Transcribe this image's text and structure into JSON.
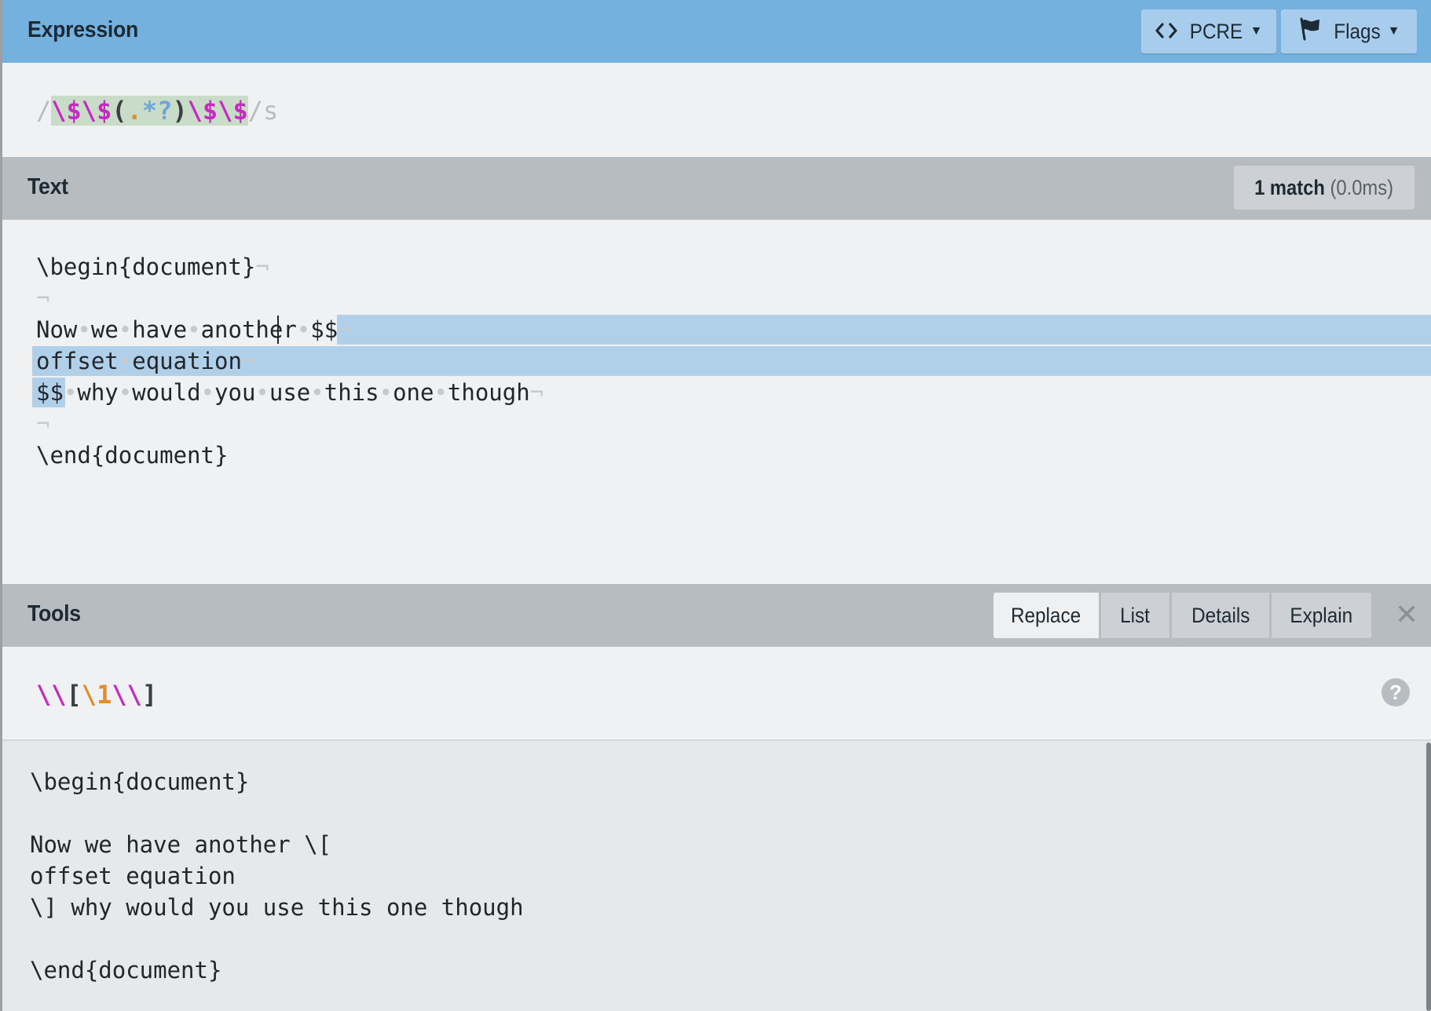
{
  "expression": {
    "title": "Expression",
    "flavor_label": "PCRE",
    "flags_label": "Flags",
    "delimiter_open": "/",
    "pattern_parts": {
      "p1": "\\$\\$",
      "p2": "(",
      "p3": ".",
      "p4": "*?",
      "p5": ")",
      "p6": "\\$\\$"
    },
    "delimiter_close": "/",
    "flags": "s"
  },
  "text_section": {
    "title": "Text",
    "match_count": "1 match",
    "match_time": "(0.0ms)",
    "lines": {
      "l1": "\\begin{document}",
      "l3a": "Now",
      "l3b": "we",
      "l3c": "have",
      "l3d": "another",
      "l3e": "$$",
      "l4a": "offset",
      "l4b": "equation",
      "l5a": "$$",
      "l5b": "why",
      "l5c": "would",
      "l5d": "you",
      "l5e": "use",
      "l5f": "this",
      "l5g": "one",
      "l5h": "though",
      "l7": "\\end{document}"
    },
    "space_glyph": "•",
    "newline_glyph": "¬"
  },
  "tools": {
    "title": "Tools",
    "tabs": {
      "replace": "Replace",
      "list": "List",
      "details": "Details",
      "explain": "Explain"
    },
    "active_tab": "replace",
    "replace_parts": {
      "r1": "\\\\",
      "r2": "[",
      "r3": "\\1",
      "r4": "\\\\",
      "r5": "]"
    },
    "help_glyph": "?",
    "close_glyph": "✕"
  },
  "result": {
    "lines": {
      "l1": "\\begin{document}",
      "l3": "Now we have another \\[",
      "l4": "offset equation",
      "l5": "\\] why would you use this one though",
      "l7": "\\end{document}"
    }
  },
  "colors": {
    "header_blue": "#75b1de",
    "bar_gray": "#b7bcc0",
    "match_highlight": "#b0d0ea",
    "escape_magenta": "#c52ac1",
    "quantifier_blue": "#6ea6dc",
    "dot_orange": "#e0902a"
  },
  "icons": {
    "flavor": "code-brackets-icon",
    "flags": "flag-icon",
    "close": "close-icon",
    "help": "help-circle-icon"
  }
}
